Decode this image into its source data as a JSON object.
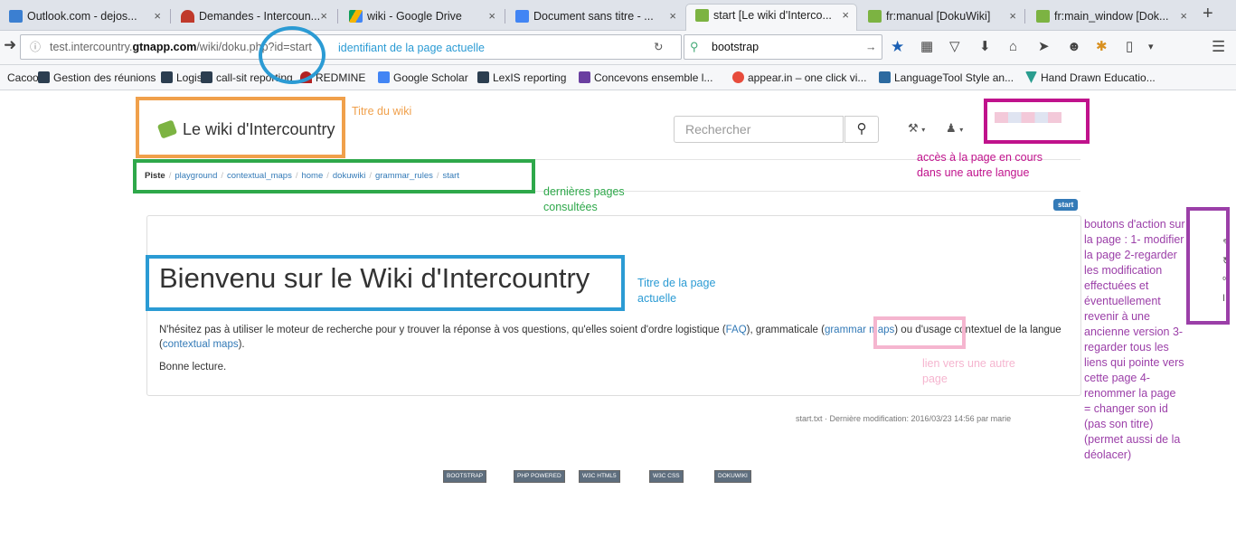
{
  "tabs": [
    {
      "title": "Outlook.com - dejos...",
      "color": "#3b7fd1"
    },
    {
      "title": "Demandes - Intercoun...",
      "color": "#c0392b"
    },
    {
      "title": "wiki - Google Drive",
      "color": "#f4b400"
    },
    {
      "title": "Document sans titre - ...",
      "color": "#4285f4"
    },
    {
      "title": "start [Le wiki d'Interco...",
      "color": "#7cb342"
    },
    {
      "title": "fr:manual [DokuWiki]",
      "color": "#7cb342"
    },
    {
      "title": "fr:main_window [Dok...",
      "color": "#7cb342"
    }
  ],
  "tab_close": "×",
  "new_tab": "+",
  "url": {
    "prefix": "test.intercountry.",
    "domain": "gtnapp.com",
    "path": "/wiki/doku.php?id=start"
  },
  "browser_search": "bootstrap",
  "bookmarks": [
    {
      "label": "Cacoo",
      "color": "#ffffff"
    },
    {
      "label": "Gestion des réunions",
      "color": "#2c3e50"
    },
    {
      "label": "Logis",
      "color": "#2c3e50"
    },
    {
      "label": "call-sit reporting",
      "color": "#2c3e50"
    },
    {
      "label": "REDMINE",
      "color": "#b22222"
    },
    {
      "label": "Google Scholar",
      "color": "#4285f4"
    },
    {
      "label": "LexIS reporting",
      "color": "#2c3e50"
    },
    {
      "label": "Concevons ensemble l...",
      "color": "#6a3fa0"
    },
    {
      "label": "appear.in – one click vi...",
      "color": "#e74c3c"
    },
    {
      "label": "LanguageTool Style an...",
      "color": "#2c6aa0"
    },
    {
      "label": "Hand Drawn Educatio...",
      "color": "#2a9d8f"
    }
  ],
  "wiki": {
    "title": "Le wiki d'Intercountry",
    "search_placeholder": "Rechercher",
    "breadcrumb_label": "Piste",
    "breadcrumbs": [
      "playground",
      "contextual_maps",
      "home",
      "dokuwiki",
      "grammar_rules",
      "start"
    ],
    "page_id_badge": "start",
    "heading": "Bienvenu sur le Wiki d'Intercountry",
    "para_1": "N'hésitez pas à utiliser le moteur de recherche pour y trouver la réponse à vos questions, qu'elles soient d'ordre logistique (",
    "link_faq": "FAQ",
    "para_2": "), grammaticale (",
    "link_grammar": "grammar maps",
    "para_3": ") ou d'usage contextuel de la langue (",
    "link_contextual": "contextual maps",
    "para_4": ").",
    "closing": "Bonne lecture.",
    "footer_info": "start.txt · Dernière modification: 2016/03/23 14:56 par marie",
    "footer_badges": [
      "BOOTSTRAP",
      "PHP POWERED",
      "W3C HTML5",
      "W3C CSS",
      "DOKUWIKI"
    ]
  },
  "annotations": {
    "page_id": "identifiant de la page actuelle",
    "wiki_title": "Titre du wiki",
    "other_language": "accès à la page en cours dans une autre langue",
    "last_pages": "dernières pages consultées",
    "page_title": "Titre de la page actuelle",
    "other_link": "lien vers une autre page",
    "action_buttons": "boutons d'action sur la page : 1- modifier la page 2-regarder les modification effectuées et éventuellement revenir à une ancienne version 3-regarder tous les liens qui pointe vers cette page 4-renommer la page = changer son id (pas son titre)(permet aussi de la déolacer)"
  },
  "colors": {
    "orange": "#f0a04b",
    "green": "#2ea84a",
    "blue": "#2b9bd4",
    "magenta": "#c0128c",
    "pink": "#f5b5cf",
    "purple": "#9b3fa8",
    "link": "#337ab7"
  }
}
